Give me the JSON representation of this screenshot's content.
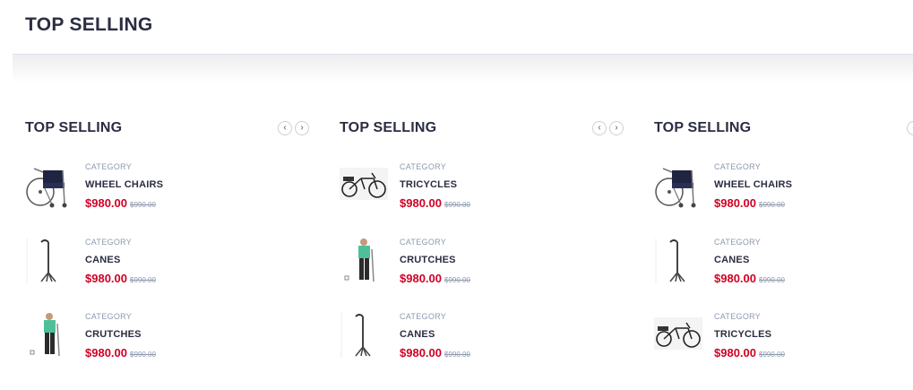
{
  "page": {
    "title": "TOP SELLING"
  },
  "columns": [
    {
      "title": "TOP SELLING",
      "nav": {
        "prev": "‹",
        "next": "›"
      },
      "products": [
        {
          "category": "CATEGORY",
          "name": "WHEEL CHAIRS",
          "price": "$980.00",
          "old_price": "$990.00",
          "image": "wheelchair-icon"
        },
        {
          "category": "CATEGORY",
          "name": "CANES",
          "price": "$980.00",
          "old_price": "$990.00",
          "image": "cane-icon"
        },
        {
          "category": "CATEGORY",
          "name": "CRUTCHES",
          "price": "$980.00",
          "old_price": "$990.00",
          "image": "crutches-icon"
        }
      ]
    },
    {
      "title": "TOP SELLING",
      "nav": {
        "prev": "‹",
        "next": "›"
      },
      "products": [
        {
          "category": "CATEGORY",
          "name": "TRICYCLES",
          "price": "$980.00",
          "old_price": "$990.00",
          "image": "tricycle-icon"
        },
        {
          "category": "CATEGORY",
          "name": "CRUTCHES",
          "price": "$980.00",
          "old_price": "$990.00",
          "image": "crutches-icon"
        },
        {
          "category": "CATEGORY",
          "name": "CANES",
          "price": "$980.00",
          "old_price": "$990.00",
          "image": "cane-icon"
        }
      ]
    },
    {
      "title": "TOP SELLING",
      "nav": {
        "prev": "‹",
        "next": "›"
      },
      "products": [
        {
          "category": "CATEGORY",
          "name": "WHEEL CHAIRS",
          "price": "$980.00",
          "old_price": "$990.00",
          "image": "wheelchair-icon"
        },
        {
          "category": "CATEGORY",
          "name": "CANES",
          "price": "$980.00",
          "old_price": "$990.00",
          "image": "cane-icon"
        },
        {
          "category": "CATEGORY",
          "name": "TRICYCLES",
          "price": "$980.00",
          "old_price": "$990.00",
          "image": "tricycle-icon"
        }
      ]
    }
  ],
  "colors": {
    "price": "#d10024",
    "muted": "#8d99ae",
    "heading": "#2b2d42"
  }
}
